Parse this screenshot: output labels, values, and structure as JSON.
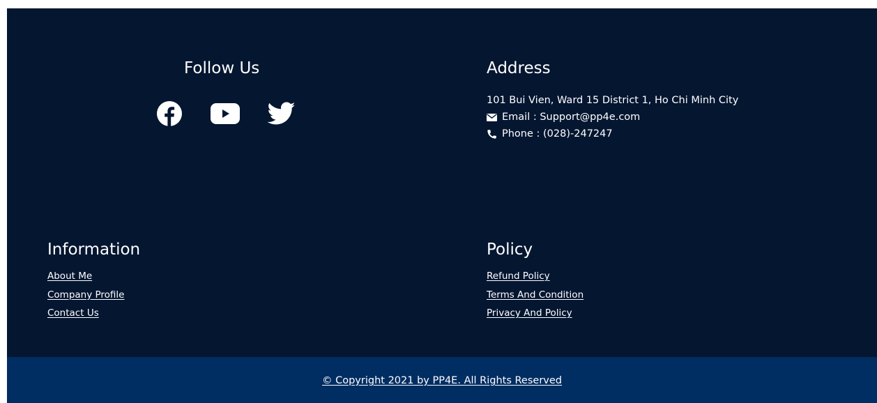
{
  "follow": {
    "title": "Follow Us",
    "icons": [
      "facebook-icon",
      "youtube-icon",
      "twitter-icon"
    ]
  },
  "address": {
    "title": "Address",
    "street": "101 Bui Vien, Ward 15 District 1, Ho Chi Minh City",
    "email": "Email : Support@pp4e.com",
    "phone": "Phone : (028)-247247",
    "icons": [
      "envelope-icon",
      "phone-icon"
    ]
  },
  "information": {
    "title": "Information",
    "links": [
      "About Me",
      "Company Profile",
      "Contact Us"
    ]
  },
  "policy": {
    "title": "Policy",
    "links": [
      "Refund Policy",
      "Terms And Condition",
      "Privacy And Policy"
    ]
  },
  "copyright": "© Copyright 2021 by PP4E. All Rights Reserved",
  "colors": {
    "footer_bg": "#051631",
    "bottom_bar_bg": "#002d62",
    "text": "#ffffff"
  }
}
